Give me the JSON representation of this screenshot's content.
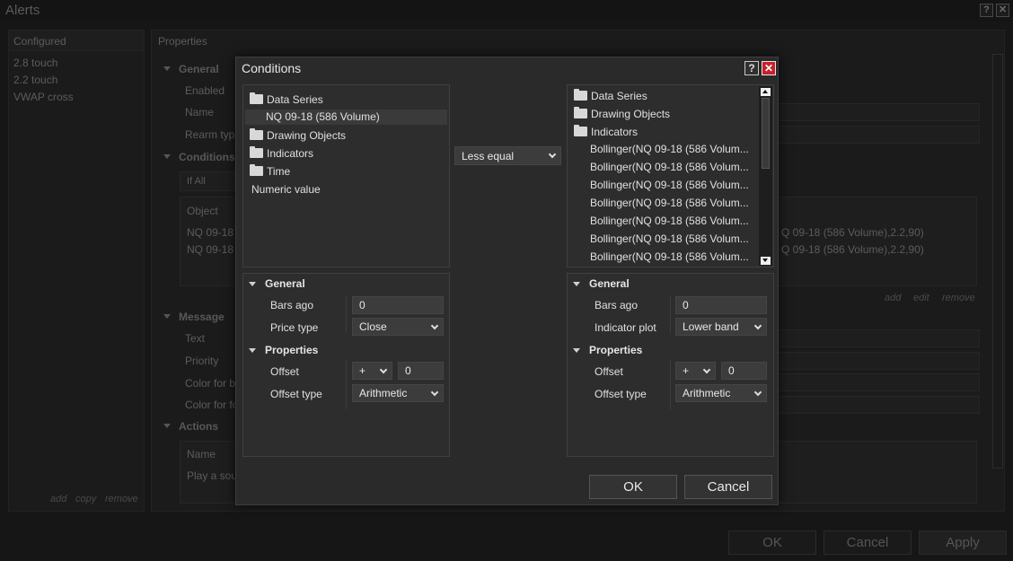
{
  "background": {
    "window_title": "Alerts",
    "configured_header": "Configured",
    "configured_items": [
      "2.8 touch",
      "2.2 touch",
      "VWAP cross"
    ],
    "left_links": [
      "add",
      "copy",
      "remove"
    ],
    "properties_header": "Properties",
    "general_header": "General",
    "general_rows": [
      "Enabled",
      "Name",
      "Rearm typ"
    ],
    "conditions_header": "Conditions",
    "ifall_value": "If All",
    "object_header": "Object",
    "condition_rows": [
      "NQ 09-18",
      "NQ 09-18"
    ],
    "condition_right_rows": [
      "Q 09-18 (586 Volume),2.2,90)",
      "Q 09-18 (586 Volume),2.2,90)"
    ],
    "cond_links": [
      "add",
      "edit",
      "remove"
    ],
    "message_header": "Message",
    "message_rows": [
      "Text",
      "Priority",
      "Color for b",
      "Color for fo"
    ],
    "actions_header": "Actions",
    "actions_name_header": "Name",
    "actions_row": "Play a sou",
    "footer_buttons": [
      "OK",
      "Cancel",
      "Apply"
    ],
    "help_glyph": "?",
    "close_glyph": "✕"
  },
  "dialog": {
    "title": "Conditions",
    "help_glyph": "?",
    "close_glyph": "✕",
    "left_tree": {
      "items": [
        "Data Series",
        "NQ 09-18 (586 Volume)",
        "Drawing Objects",
        "Indicators",
        "Time",
        "Numeric value"
      ]
    },
    "operator": "Less equal",
    "right_tree": {
      "items": [
        "Data Series",
        "Drawing Objects",
        "Indicators"
      ],
      "bollinger_items": [
        "Bollinger(NQ 09-18 (586 Volum...",
        "Bollinger(NQ 09-18 (586 Volum...",
        "Bollinger(NQ 09-18 (586 Volum...",
        "Bollinger(NQ 09-18 (586 Volum...",
        "Bollinger(NQ 09-18 (586 Volum...",
        "Bollinger(NQ 09-18 (586 Volum...",
        "Bollinger(NQ 09-18 (586 Volum..."
      ]
    },
    "left_props": {
      "general_header": "General",
      "bars_ago_label": "Bars ago",
      "bars_ago_value": "0",
      "price_type_label": "Price type",
      "price_type_value": "Close",
      "properties_header": "Properties",
      "offset_label": "Offset",
      "offset_sign": "+",
      "offset_value": "0",
      "offset_type_label": "Offset type",
      "offset_type_value": "Arithmetic"
    },
    "right_props": {
      "general_header": "General",
      "bars_ago_label": "Bars ago",
      "bars_ago_value": "0",
      "indicator_plot_label": "Indicator plot",
      "indicator_plot_value": "Lower band",
      "properties_header": "Properties",
      "offset_label": "Offset",
      "offset_sign": "+",
      "offset_value": "0",
      "offset_type_label": "Offset type",
      "offset_type_value": "Arithmetic"
    },
    "ok_label": "OK",
    "cancel_label": "Cancel"
  }
}
